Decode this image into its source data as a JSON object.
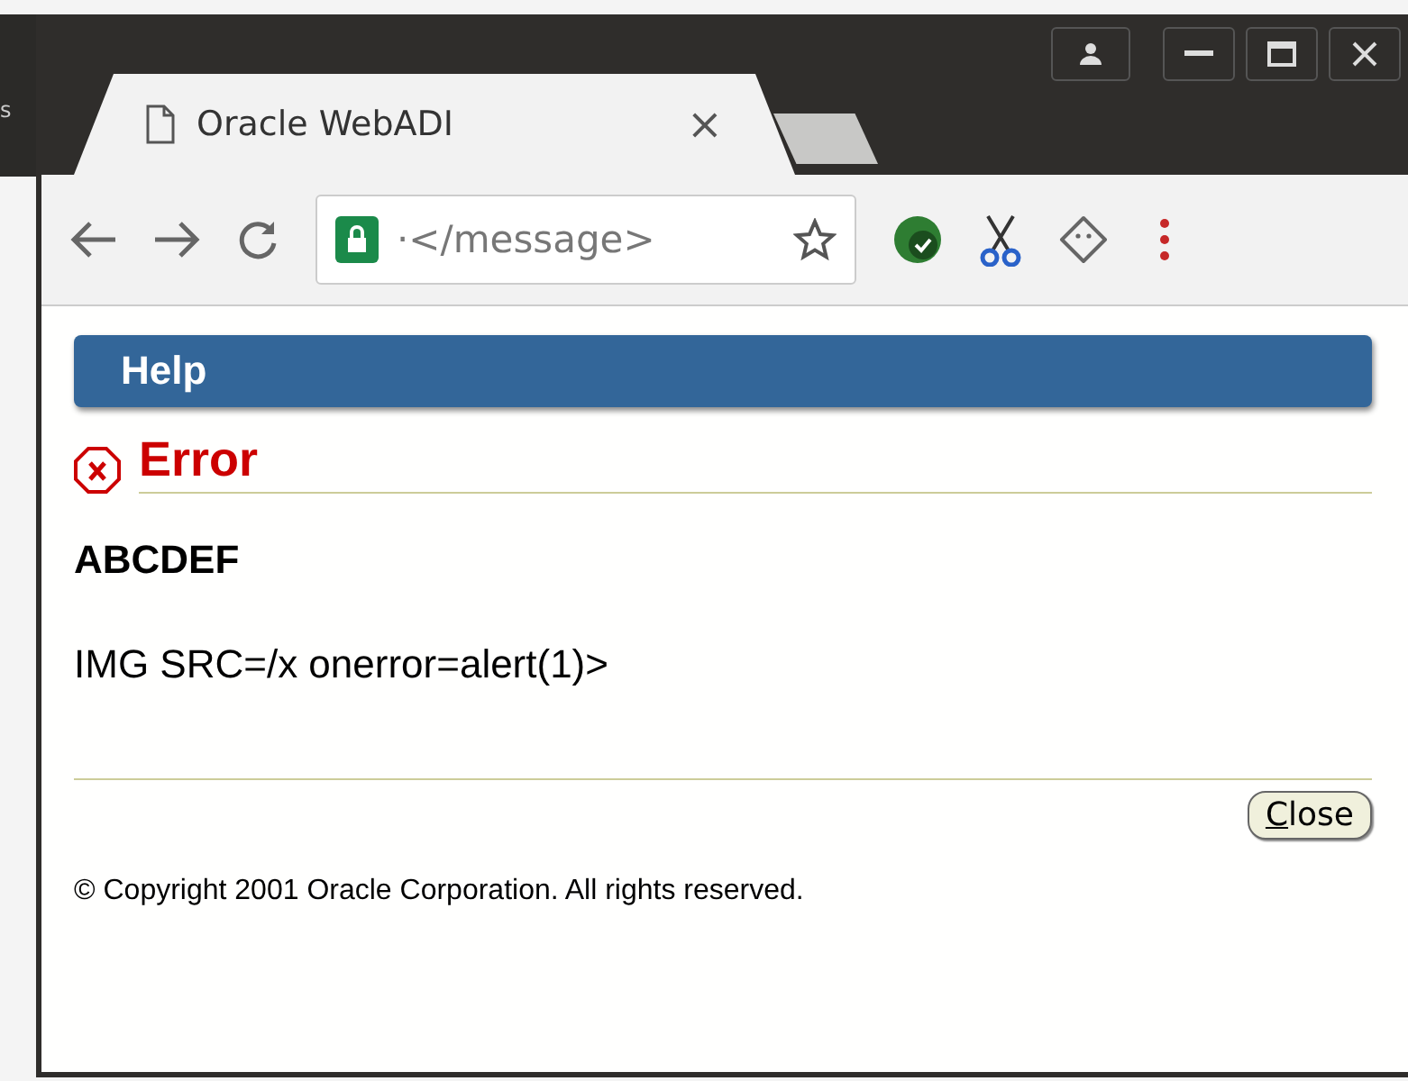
{
  "desktop": {
    "text": "s"
  },
  "window": {
    "controls": [
      {
        "kind": "profile"
      },
      {
        "kind": "minimize"
      },
      {
        "kind": "maximize"
      },
      {
        "kind": "close"
      }
    ]
  },
  "tabs": [
    {
      "label": "Oracle WebADI",
      "close": "×",
      "selected": true
    },
    {
      "kind": "new",
      "selected": false
    }
  ],
  "address_bar": {
    "value": "·</message>",
    "secure": true
  },
  "extensions": [
    {
      "kind": "badge"
    },
    {
      "kind": "scissors"
    },
    {
      "kind": "ghost"
    }
  ],
  "page": {
    "header": "Help",
    "error_title": "Error",
    "heading": "ABCDEF",
    "message": "IMG SRC=/x onerror=alert(1)>",
    "button": {
      "label": "Close",
      "mnemonic": true
    },
    "copyright": "© Copyright 2001 Oracle Corporation. All rights reserved."
  }
}
